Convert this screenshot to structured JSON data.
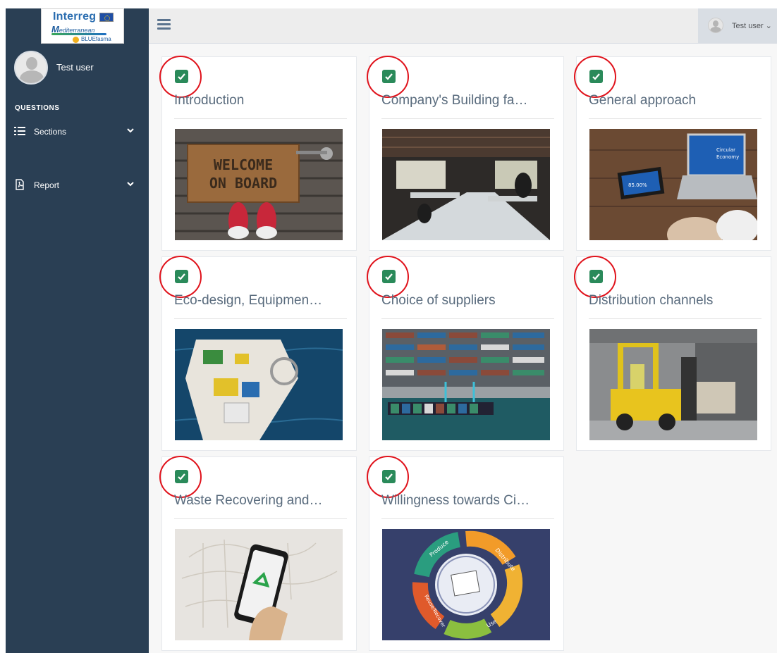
{
  "sidebar": {
    "logo": {
      "line1": "Interreg",
      "line2_initial": "M",
      "line2_rest": "editerranean",
      "line3": "BLUEfasma"
    },
    "profile_name": "Test user",
    "section_heading": "QUESTIONS",
    "nav": [
      {
        "label": "Sections",
        "icon": "list-icon"
      },
      {
        "label": "Report",
        "icon": "pdf-file-icon"
      }
    ]
  },
  "topbar": {
    "user_label": "Test user ⌄"
  },
  "cards": [
    {
      "title": "Introduction",
      "completed": true,
      "image": "welcome-doormat-photo"
    },
    {
      "title": "Company's Building fa…",
      "completed": true,
      "image": "open-office-photo"
    },
    {
      "title": "General approach",
      "completed": true,
      "image": "circular-economy-laptop-photo"
    },
    {
      "title": "Eco-design, Equipmen…",
      "completed": true,
      "image": "fishing-boat-photo"
    },
    {
      "title": "Choice of suppliers",
      "completed": true,
      "image": "container-port-photo"
    },
    {
      "title": "Distribution channels",
      "completed": true,
      "image": "forklift-warehouse-photo"
    },
    {
      "title": "Waste Recovering and…",
      "completed": true,
      "image": "recycling-phone-photo"
    },
    {
      "title": "Willingness towards Ci…",
      "completed": true,
      "image": "circular-economy-diagram"
    }
  ],
  "diagram_text": {
    "produce": "Produce",
    "distribute": "Distribute",
    "use": "Use",
    "reuse": "Reuse/Recover"
  },
  "doormat_text": [
    "WELCOME",
    "ON BOARD"
  ],
  "laptop_text": [
    "Circular",
    "Economy",
    "85.00%"
  ],
  "colors": {
    "sidebar": "#2a3f54",
    "topbar": "#ededed",
    "content_bg": "#f7f7f7",
    "check": "#2a8a5a",
    "highlight_ring": "#e0131c",
    "card_title": "#596b7d"
  }
}
